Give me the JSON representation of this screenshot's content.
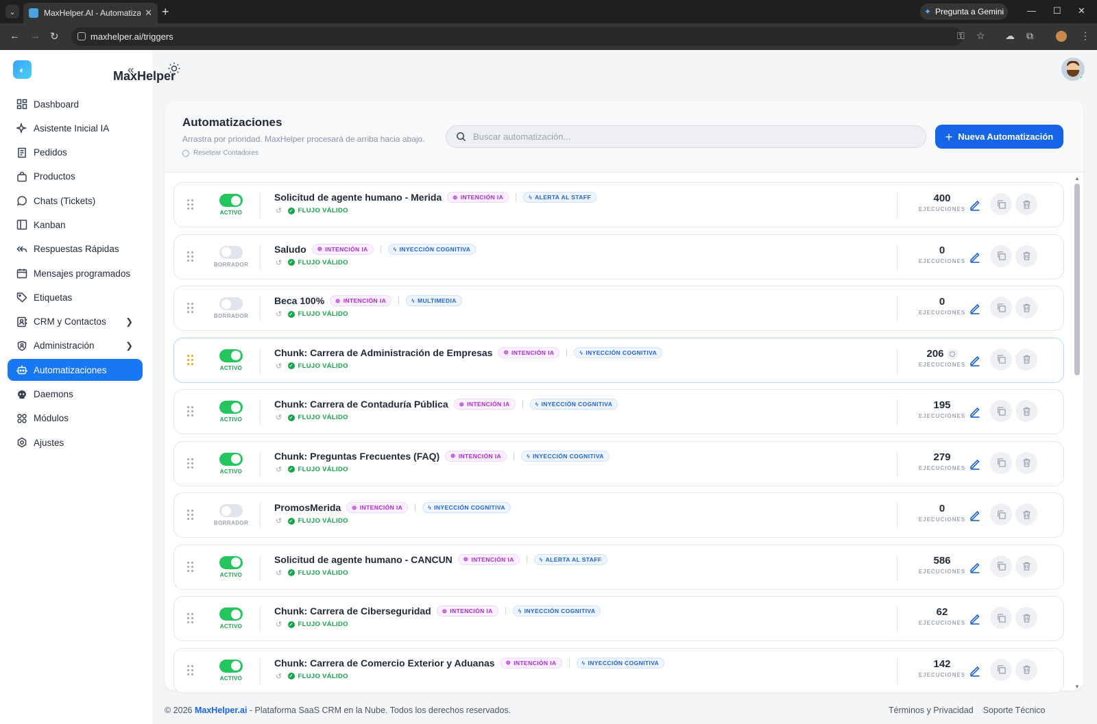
{
  "browser": {
    "tab_title": "MaxHelper.AI - Automatiza tu a",
    "url": "maxhelper.ai/triggers",
    "gemini_label": "Pregunta a Gemini"
  },
  "brand": {
    "name": "MaxHelper"
  },
  "sidebar": {
    "items": [
      {
        "label": "Dashboard",
        "icon": "dashboard-icon"
      },
      {
        "label": "Asistente Inicial IA",
        "icon": "sparkle-icon"
      },
      {
        "label": "Pedidos",
        "icon": "receipt-icon"
      },
      {
        "label": "Productos",
        "icon": "bag-icon"
      },
      {
        "label": "Chats (Tickets)",
        "icon": "whatsapp-icon"
      },
      {
        "label": "Kanban",
        "icon": "kanban-icon"
      },
      {
        "label": "Respuestas Rápidas",
        "icon": "reply-all-icon"
      },
      {
        "label": "Mensajes programados",
        "icon": "calendar-icon"
      },
      {
        "label": "Etiquetas",
        "icon": "tag-icon"
      },
      {
        "label": "CRM y Contactos",
        "icon": "contacts-icon"
      },
      {
        "label": "Administración",
        "icon": "shield-user-icon"
      },
      {
        "label": "Automatizaciones",
        "icon": "robot-icon"
      },
      {
        "label": "Daemons",
        "icon": "daemon-icon"
      },
      {
        "label": "Módulos",
        "icon": "modules-icon"
      },
      {
        "label": "Ajustes",
        "icon": "gear-icon"
      }
    ]
  },
  "header": {
    "title": "Automatizaciones",
    "subtitle": "Arrastra por prioridad. MaxHelper procesará de arriba hacia abajo.",
    "reset_label": "Resetear Contadores",
    "search_placeholder": "Buscar automatización...",
    "new_button": "Nueva Automatización"
  },
  "labels": {
    "flow_valid": "FLUJO VÁLIDO",
    "executions": "EJECUCIONES"
  },
  "automations": [
    {
      "name": "Solicitud de agente humano - Merida",
      "status": "ACTIVO",
      "active": true,
      "intent": "INTENCIÓN IA",
      "action": "ALERTA AL STAFF",
      "count": "400"
    },
    {
      "name": "Saludo",
      "status": "BORRADOR",
      "active": false,
      "intent": "INTENCIÓN IA",
      "action": "INYECCIÓN COGNITIVA",
      "count": "0"
    },
    {
      "name": "Beca 100%",
      "status": "BORRADOR",
      "active": false,
      "intent": "INTENCIÓN IA",
      "action": "MULTIMEDIA",
      "count": "0"
    },
    {
      "name": "Chunk: Carrera de Administración de Empresas",
      "status": "ACTIVO",
      "active": true,
      "intent": "INTENCIÓN IA",
      "action": "INYECCIÓN COGNITIVA",
      "count": "206"
    },
    {
      "name": "Chunk: Carrera de Contaduría Pública",
      "status": "ACTIVO",
      "active": true,
      "intent": "INTENCIÓN IA",
      "action": "INYECCIÓN COGNITIVA",
      "count": "195"
    },
    {
      "name": "Chunk: Preguntas Frecuentes (FAQ)",
      "status": "ACTIVO",
      "active": true,
      "intent": "INTENCIÓN IA",
      "action": "INYECCIÓN COGNITIVA",
      "count": "279"
    },
    {
      "name": "PromosMerida",
      "status": "BORRADOR",
      "active": false,
      "intent": "INTENCIÓN IA",
      "action": "INYECCIÓN COGNITIVA",
      "count": "0"
    },
    {
      "name": "Solicitud de agente humano - CANCUN",
      "status": "ACTIVO",
      "active": true,
      "intent": "INTENCIÓN IA",
      "action": "ALERTA AL STAFF",
      "count": "586"
    },
    {
      "name": "Chunk: Carrera de Ciberseguridad",
      "status": "ACTIVO",
      "active": true,
      "intent": "INTENCIÓN IA",
      "action": "INYECCIÓN COGNITIVA",
      "count": "62"
    },
    {
      "name": "Chunk: Carrera de Comercio Exterior y Aduanas",
      "status": "ACTIVO",
      "active": true,
      "intent": "INTENCIÓN IA",
      "action": "INYECCIÓN COGNITIVA",
      "count": "142"
    }
  ],
  "footer": {
    "copyright": "© 2026",
    "brand_link": "MaxHelper.ai",
    "tagline": "- Plataforma SaaS CRM en la Nube. Todos los derechos reservados.",
    "terms": "Términos y Privacidad",
    "support": "Soporte Técnico"
  },
  "colors": {
    "accent": "#1665e8",
    "active_green": "#22c55e",
    "ia_purple": "#b027d6"
  }
}
